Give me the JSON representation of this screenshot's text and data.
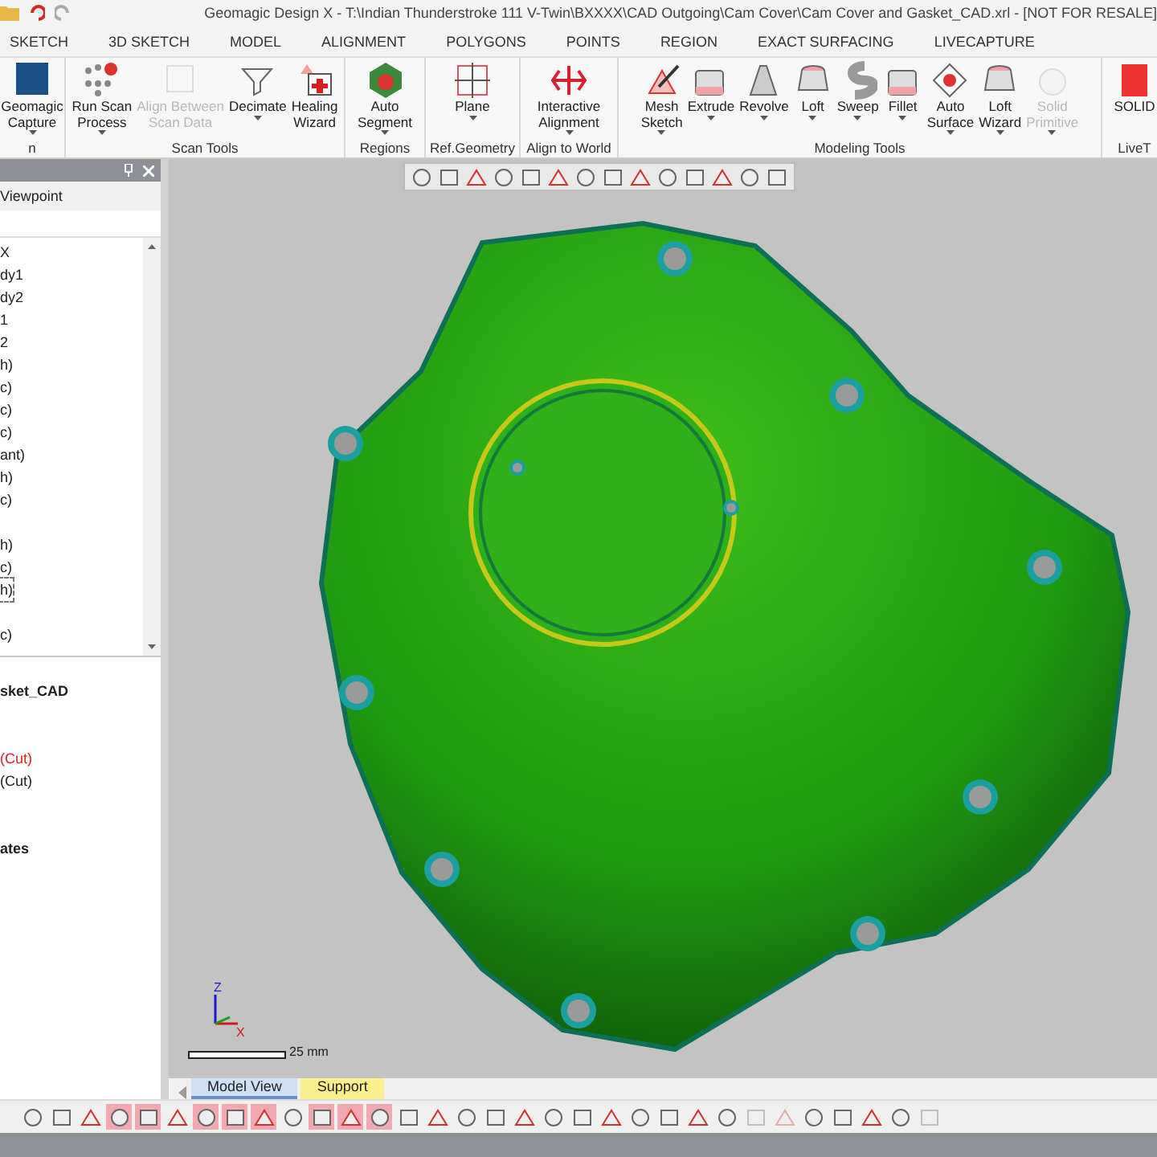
{
  "window": {
    "title": "Geomagic Design X - T:\\Indian Thunderstroke 111 V-Twin\\BXXXX\\CAD Outgoing\\Cam Cover\\Cam Cover and Gasket_CAD.xrl - [NOT FOR RESALE]"
  },
  "tabs": [
    {
      "label": "SKETCH",
      "selected": false
    },
    {
      "label": "3D SKETCH",
      "selected": false
    },
    {
      "label": "MODEL",
      "selected": false
    },
    {
      "label": "ALIGNMENT",
      "selected": false
    },
    {
      "label": "POLYGONS",
      "selected": false
    },
    {
      "label": "POINTS",
      "selected": false
    },
    {
      "label": "REGION",
      "selected": false
    },
    {
      "label": "EXACT SURFACING",
      "selected": false
    },
    {
      "label": "LIVECAPTURE",
      "selected": false
    }
  ],
  "ribbon": [
    {
      "label": "n",
      "buttons": [
        {
          "lines": [
            "Geomagic",
            "Capture"
          ],
          "dropdown": true,
          "disabled": false,
          "kind": "capture"
        }
      ]
    },
    {
      "label": "Scan Tools",
      "buttons": [
        {
          "lines": [
            "Run Scan",
            "Process"
          ],
          "dropdown": true,
          "disabled": false,
          "kind": "dots"
        },
        {
          "lines": [
            "Align Between",
            "Scan Data"
          ],
          "dropdown": false,
          "disabled": true,
          "kind": "grid"
        },
        {
          "lines": [
            "Decimate"
          ],
          "dropdown": true,
          "disabled": false,
          "kind": "funnel"
        },
        {
          "lines": [
            "Healing",
            "Wizard"
          ],
          "dropdown": false,
          "disabled": false,
          "kind": "heal"
        }
      ]
    },
    {
      "label": "Regions",
      "buttons": [
        {
          "lines": [
            "Auto",
            "Segment"
          ],
          "dropdown": true,
          "disabled": false,
          "kind": "segment"
        }
      ]
    },
    {
      "label": "Ref.Geometry",
      "buttons": [
        {
          "lines": [
            "Plane"
          ],
          "dropdown": true,
          "disabled": false,
          "kind": "plane"
        }
      ]
    },
    {
      "label": "Align to World",
      "buttons": [
        {
          "lines": [
            "Interactive",
            "Alignment"
          ],
          "dropdown": true,
          "disabled": false,
          "kind": "align"
        }
      ]
    },
    {
      "label": "Modeling Tools",
      "buttons": [
        {
          "lines": [
            "Mesh",
            "Sketch"
          ],
          "dropdown": true,
          "disabled": false,
          "kind": "sketch"
        },
        {
          "lines": [
            "Extrude"
          ],
          "dropdown": true,
          "disabled": false,
          "kind": "box"
        },
        {
          "lines": [
            "Revolve"
          ],
          "dropdown": true,
          "disabled": false,
          "kind": "revolve"
        },
        {
          "lines": [
            "Loft"
          ],
          "dropdown": true,
          "disabled": false,
          "kind": "loft"
        },
        {
          "lines": [
            "Sweep"
          ],
          "dropdown": true,
          "disabled": false,
          "kind": "sweep"
        },
        {
          "lines": [
            "Fillet"
          ],
          "dropdown": true,
          "disabled": false,
          "kind": "box"
        },
        {
          "lines": [
            "Auto",
            "Surface"
          ],
          "dropdown": true,
          "disabled": false,
          "kind": "surface"
        },
        {
          "lines": [
            "Loft",
            "Wizard"
          ],
          "dropdown": true,
          "disabled": false,
          "kind": "loft"
        },
        {
          "lines": [
            "Solid",
            "Primitive"
          ],
          "dropdown": true,
          "disabled": true,
          "kind": "sphere"
        }
      ]
    },
    {
      "label": "LiveT",
      "buttons": [
        {
          "lines": [
            "SOLID"
          ],
          "dropdown": false,
          "disabled": false,
          "kind": "solid"
        }
      ]
    }
  ],
  "panel": {
    "viewpoint": "Viewpoint",
    "tree": [
      {
        "kind": "item",
        "label": "X",
        "focused": false
      },
      {
        "kind": "item",
        "label": "dy1",
        "focused": false
      },
      {
        "kind": "item",
        "label": "dy2",
        "focused": false
      },
      {
        "kind": "item",
        "label": "1",
        "focused": false
      },
      {
        "kind": "item",
        "label": "2",
        "focused": false
      },
      {
        "kind": "item",
        "label": "h)",
        "focused": false
      },
      {
        "kind": "item",
        "label": "c)",
        "focused": false
      },
      {
        "kind": "item",
        "label": "c)",
        "focused": false
      },
      {
        "kind": "item",
        "label": "c)",
        "focused": false
      },
      {
        "kind": "item",
        "label": "ant)",
        "focused": false
      },
      {
        "kind": "item",
        "label": "h)",
        "focused": false
      },
      {
        "kind": "item",
        "label": "c)",
        "focused": false
      },
      {
        "kind": "blank"
      },
      {
        "kind": "item",
        "label": "h)",
        "focused": false
      },
      {
        "kind": "item",
        "label": "c)",
        "focused": false
      },
      {
        "kind": "item",
        "label": "h)",
        "focused": true
      },
      {
        "kind": "blank"
      },
      {
        "kind": "item",
        "label": "c)",
        "focused": false
      }
    ],
    "features": [
      {
        "label": "sket_CAD",
        "kind": "heading"
      },
      {
        "kind": "blank"
      },
      {
        "kind": "blank"
      },
      {
        "label": "(Cut)",
        "kind": "error"
      },
      {
        "label": "(Cut)",
        "kind": "item"
      },
      {
        "kind": "blank"
      },
      {
        "kind": "blank"
      },
      {
        "label": "ates",
        "kind": "heading"
      }
    ]
  },
  "viewport": {
    "axis_z": "Z",
    "axis_x": "X",
    "scale": "25 mm",
    "tabs": [
      {
        "label": "Model View",
        "selected": true,
        "color": "#cfe0f5"
      },
      {
        "label": "Support",
        "selected": false,
        "color": "#fbee8c"
      }
    ]
  },
  "bottom_toolbar": [
    {
      "on": false,
      "disabled": false
    },
    {
      "on": false,
      "disabled": false
    },
    {
      "on": false,
      "disabled": false
    },
    {
      "on": true,
      "disabled": false
    },
    {
      "on": true,
      "disabled": false
    },
    {
      "on": false,
      "disabled": false
    },
    {
      "on": true,
      "disabled": false
    },
    {
      "on": true,
      "disabled": false
    },
    {
      "on": true,
      "disabled": false
    },
    {
      "on": false,
      "disabled": false
    },
    {
      "on": true,
      "disabled": false
    },
    {
      "on": true,
      "disabled": false
    },
    {
      "on": true,
      "disabled": false
    },
    {
      "on": false,
      "disabled": false
    },
    {
      "on": false,
      "disabled": false
    },
    {
      "on": false,
      "disabled": false
    },
    {
      "on": false,
      "disabled": false
    },
    {
      "on": false,
      "disabled": false
    },
    {
      "on": false,
      "disabled": false
    },
    {
      "on": false,
      "disabled": false
    },
    {
      "on": false,
      "disabled": false
    },
    {
      "on": false,
      "disabled": false
    },
    {
      "on": false,
      "disabled": false
    },
    {
      "on": false,
      "disabled": false
    },
    {
      "on": false,
      "disabled": false
    },
    {
      "on": false,
      "disabled": true
    },
    {
      "on": false,
      "disabled": true
    },
    {
      "on": false,
      "disabled": false
    },
    {
      "on": false,
      "disabled": false
    },
    {
      "on": false,
      "disabled": false
    },
    {
      "on": false,
      "disabled": false
    },
    {
      "on": false,
      "disabled": true
    }
  ]
}
